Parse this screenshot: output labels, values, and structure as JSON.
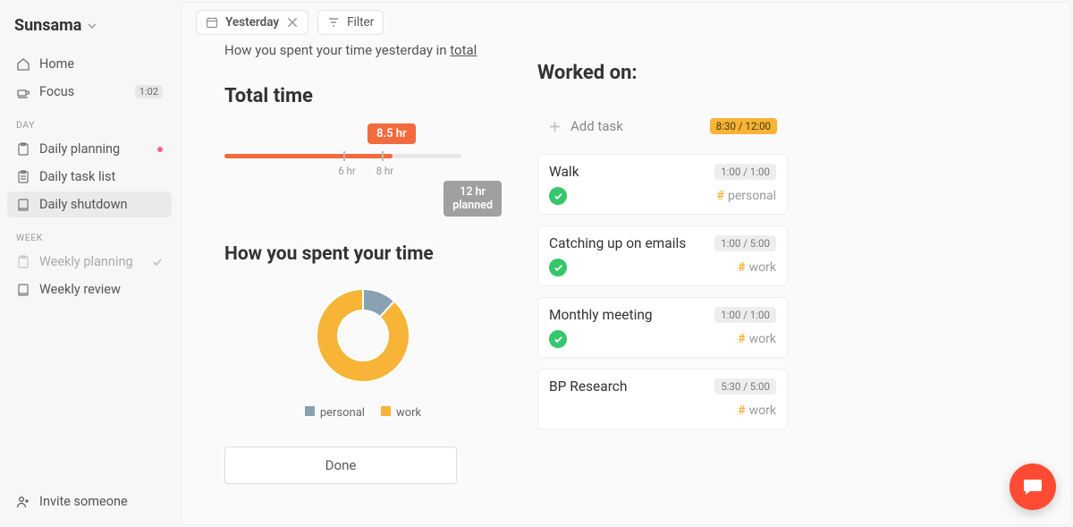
{
  "brand": "Sunsama",
  "sidebar": {
    "primary": [
      {
        "label": "Home"
      },
      {
        "label": "Focus",
        "badge": "1:02"
      }
    ],
    "day_header": "DAY",
    "day": [
      {
        "label": "Daily planning",
        "has_dot": true
      },
      {
        "label": "Daily task list"
      },
      {
        "label": "Daily shutdown",
        "active": true
      }
    ],
    "week_header": "WEEK",
    "week": [
      {
        "label": "Weekly planning",
        "muted": true,
        "check": true
      },
      {
        "label": "Weekly review"
      }
    ],
    "invite": "Invite someone"
  },
  "topbar": {
    "yesterday": "Yesterday",
    "filter": "Filter"
  },
  "summary": {
    "line_pre": "How you spent your time yesterday in ",
    "line_link": "total"
  },
  "total": {
    "heading": "Total time",
    "actual_pill": "8.5 hr",
    "tick6": "6 hr",
    "tick8": "8 hr",
    "planned_l1": "12 hr",
    "planned_l2": "planned"
  },
  "spent": {
    "heading": "How you spent your time",
    "legend_personal": "personal",
    "legend_work": "work"
  },
  "done_label": "Done",
  "worked": {
    "heading": "Worked on:",
    "add_label": "Add task",
    "add_chip": "8:30 / 12:00",
    "tasks": [
      {
        "title": "Walk",
        "time": "1:00 / 1:00",
        "tag": "personal",
        "done": true
      },
      {
        "title": "Catching up on emails",
        "time": "1:00 / 5:00",
        "tag": "work",
        "done": true
      },
      {
        "title": "Monthly meeting",
        "time": "1:00 / 1:00",
        "tag": "work",
        "done": true
      },
      {
        "title": "BP Research",
        "time": "5:30 / 5:00",
        "tag": "work",
        "done": false
      }
    ]
  },
  "chart_data": {
    "type": "pie",
    "title": "How you spent your time",
    "series": [
      {
        "name": "personal",
        "value": 1.0,
        "color": "#8aa0b3"
      },
      {
        "name": "work",
        "value": 7.5,
        "color": "#f7b437"
      }
    ],
    "total_hours": 8.5,
    "planned_hours": 12
  }
}
